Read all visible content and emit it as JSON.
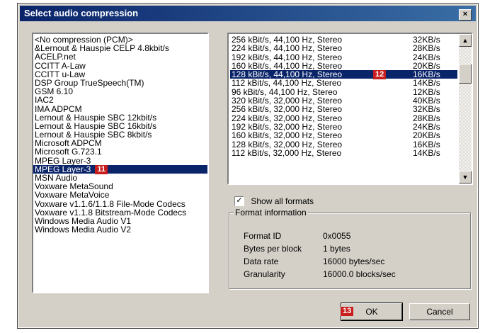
{
  "window": {
    "title": "Select audio compression",
    "close_label": "×"
  },
  "codecs": {
    "items": [
      "<No compression (PCM)>",
      "&Lernout & Hauspie CELP 4.8kbit/s",
      "ACELP.net",
      "CCITT A-Law",
      "CCITT u-Law",
      "DSP Group TrueSpeech(TM)",
      "GSM 6.10",
      "IAC2",
      "IMA ADPCM",
      "Lernout & Hauspie SBC 12kbit/s",
      "Lernout & Hauspie SBC 16kbit/s",
      "Lernout & Hauspie SBC 8kbit/s",
      "Microsoft ADPCM",
      "Microsoft G.723.1",
      "MPEG Layer-3",
      "MPEG Layer-3",
      "MSN Audio",
      "Voxware MetaSound",
      "Voxware MetaVoice",
      "Voxware v1.1.6/1.1.8 File-Mode Codecs",
      "Voxware v1.1.8 Bitstream-Mode Codecs",
      "Windows Media Audio V1",
      "Windows Media Audio V2"
    ],
    "selected_index": 15,
    "badge": "11"
  },
  "formats": {
    "rows": [
      {
        "name": "256 kBit/s, 44,100 Hz, Stereo",
        "rate": "32KB/s"
      },
      {
        "name": "224 kBit/s, 44,100 Hz, Stereo",
        "rate": "28KB/s"
      },
      {
        "name": "192 kBit/s, 44,100 Hz, Stereo",
        "rate": "24KB/s"
      },
      {
        "name": "160 kBit/s, 44,100 Hz, Stereo",
        "rate": "20KB/s"
      },
      {
        "name": "128 kBit/s, 44,100 Hz, Stereo",
        "rate": "16KB/s"
      },
      {
        "name": "112 kBit/s, 44,100 Hz, Stereo",
        "rate": "14KB/s"
      },
      {
        "name": "96 kBit/s, 44,100 Hz, Stereo",
        "rate": "12KB/s"
      },
      {
        "name": "320 kBit/s, 32,000 Hz, Stereo",
        "rate": "40KB/s"
      },
      {
        "name": "256 kBit/s, 32,000 Hz, Stereo",
        "rate": "32KB/s"
      },
      {
        "name": "224 kBit/s, 32,000 Hz, Stereo",
        "rate": "28KB/s"
      },
      {
        "name": "192 kBit/s, 32,000 Hz, Stereo",
        "rate": "24KB/s"
      },
      {
        "name": "160 kBit/s, 32,000 Hz, Stereo",
        "rate": "20KB/s"
      },
      {
        "name": "128 kBit/s, 32,000 Hz, Stereo",
        "rate": "16KB/s"
      },
      {
        "name": "112 kBit/s, 32,000 Hz, Stereo",
        "rate": "14KB/s"
      }
    ],
    "selected_index": 4,
    "badge": "12",
    "scroll_up_icon": "▲",
    "scroll_down_icon": "▼"
  },
  "show_all": {
    "label": "Show all formats",
    "checked": true,
    "check_glyph": "✓"
  },
  "format_info": {
    "title": "Format information",
    "rows": [
      {
        "label": "Format ID",
        "value": "0x0055"
      },
      {
        "label": "Bytes per block",
        "value": "1 bytes"
      },
      {
        "label": "Data rate",
        "value": "16000 bytes/sec"
      },
      {
        "label": "Granularity",
        "value": "16000.0 blocks/sec"
      }
    ]
  },
  "buttons": {
    "ok_label": "OK",
    "ok_badge": "13",
    "cancel_label": "Cancel"
  }
}
